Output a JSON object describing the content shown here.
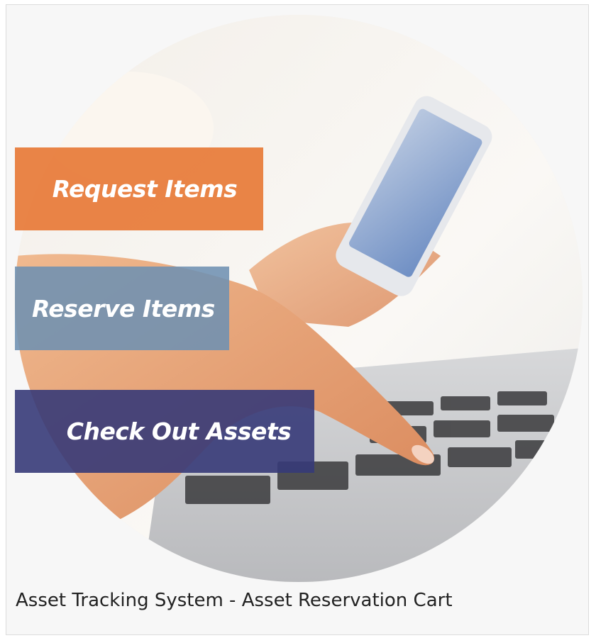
{
  "card": {
    "background_color": "#f7f7f7",
    "image": {
      "description_icon": "hands-typing-on-laptop-holding-smartphone-photo",
      "banners": [
        {
          "label": "Request Items",
          "color": "#e77a37"
        },
        {
          "label": "Reserve Items",
          "color": "#6e91b2"
        },
        {
          "label": "Check Out Assets",
          "color": "#363a78"
        }
      ]
    },
    "caption": "Asset Tracking System - Asset Reservation Cart"
  }
}
